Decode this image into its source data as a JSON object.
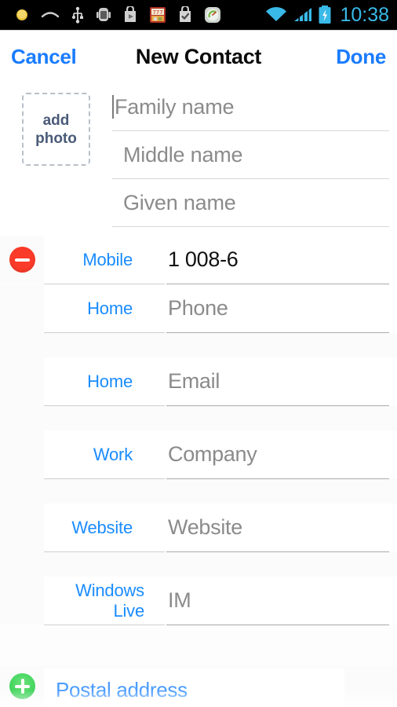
{
  "statusbar": {
    "time": "10:38",
    "left_icons": [
      "brightness-icon",
      "sleep-icon",
      "usb-icon",
      "android-robot-icon",
      "play-store-icon",
      "slots-game-icon",
      "tasks-icon",
      "speedometer-icon"
    ],
    "right_icons": [
      "wifi-icon",
      "signal-icon",
      "battery-charging-icon"
    ],
    "clock_color": "#39b9e8"
  },
  "navbar": {
    "cancel_label": "Cancel",
    "title": "New Contact",
    "done_label": "Done",
    "accent_color": "#1a7cff"
  },
  "name_card": {
    "photo_button": {
      "line1": "add",
      "line2": "photo"
    },
    "fields": [
      {
        "placeholder": "Family name",
        "value": "",
        "focused": true
      },
      {
        "placeholder": "Middle name",
        "value": "",
        "focused": false
      },
      {
        "placeholder": "Given name",
        "value": "",
        "focused": false
      }
    ]
  },
  "fields": [
    {
      "label": "Mobile",
      "placeholder": "Phone",
      "value": "1 008-6",
      "has_remove": true,
      "gap_before": false
    },
    {
      "label": "Home",
      "placeholder": "Phone",
      "value": "",
      "has_remove": false,
      "gap_before": false
    },
    {
      "label": "Home",
      "placeholder": "Email",
      "value": "",
      "has_remove": false,
      "gap_before": true
    },
    {
      "label": "Work",
      "placeholder": "Company",
      "value": "",
      "has_remove": false,
      "gap_before": true
    },
    {
      "label": "Website",
      "placeholder": "Website",
      "value": "",
      "has_remove": false,
      "gap_before": true
    },
    {
      "label": "Windows Live",
      "placeholder": "IM",
      "value": "",
      "has_remove": false,
      "gap_before": true
    }
  ],
  "footer": {
    "add_label": "Postal address",
    "add_icon": "plus-circle-icon"
  },
  "colors": {
    "accent_blue": "#1a8cff",
    "remove_red": "#fa3b29",
    "add_green": "#4cd964",
    "placeholder_gray": "#8b8b8b",
    "separator": "#cfcfcf"
  }
}
